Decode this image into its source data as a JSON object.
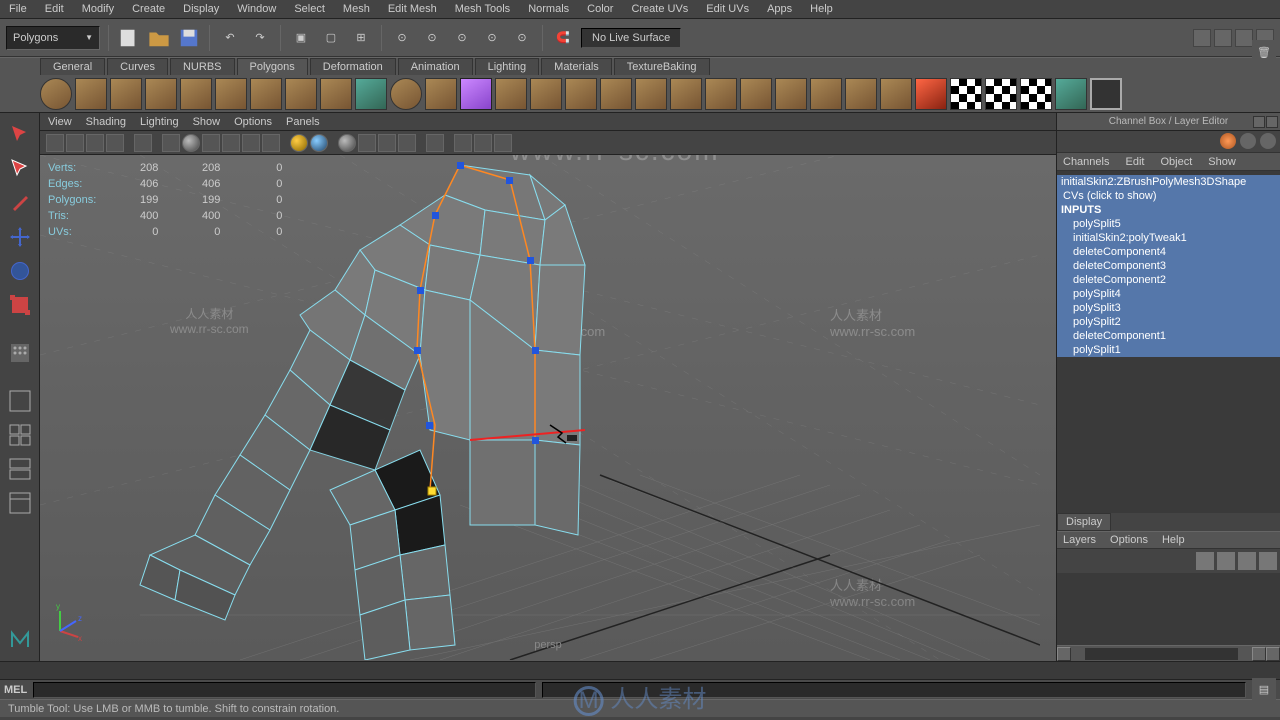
{
  "menus": [
    "File",
    "Edit",
    "Modify",
    "Create",
    "Display",
    "Window",
    "Select",
    "Mesh",
    "Edit Mesh",
    "Mesh Tools",
    "Normals",
    "Color",
    "Create UVs",
    "Edit UVs",
    "Apps",
    "Help"
  ],
  "mode": "Polygons",
  "no_live": "No Live Surface",
  "shelf_tabs": [
    "General",
    "Curves",
    "NURBS",
    "Polygons",
    "Deformation",
    "Animation",
    "Lighting",
    "Materials",
    "TextureBaking"
  ],
  "active_shelf_tab": "Polygons",
  "panel_menu": [
    "View",
    "Shading",
    "Lighting",
    "Show",
    "Options",
    "Panels"
  ],
  "hud": {
    "rows": [
      {
        "label": "Verts:",
        "v1": "208",
        "v2": "208",
        "v3": "0"
      },
      {
        "label": "Edges:",
        "v1": "406",
        "v2": "406",
        "v3": "0"
      },
      {
        "label": "Polygons:",
        "v1": "199",
        "v2": "199",
        "v3": "0"
      },
      {
        "label": "Tris:",
        "v1": "400",
        "v2": "400",
        "v3": "0"
      },
      {
        "label": "UVs:",
        "v1": "0",
        "v2": "0",
        "v3": "0"
      }
    ]
  },
  "camera": "persp",
  "channel_box": {
    "title": "Channel Box / Layer Editor",
    "menu": [
      "Channels",
      "Edit",
      "Object",
      "Show"
    ],
    "shape": "initialSkin2:ZBrushPolyMesh3DShape",
    "cvs": "CVs (click to show)",
    "inputs_label": "INPUTS",
    "inputs": [
      "polySplit5",
      "initialSkin2:polyTweak1",
      "deleteComponent4",
      "deleteComponent3",
      "deleteComponent2",
      "polySplit4",
      "polySplit3",
      "polySplit2",
      "deleteComponent1",
      "polySplit1"
    ]
  },
  "display_tab": "Display",
  "layers_menu": [
    "Layers",
    "Options",
    "Help"
  ],
  "mel_label": "MEL",
  "help_text": "Tumble Tool: Use LMB or MMB to tumble. Shift to constrain rotation.",
  "watermark_url": "www.rr-sc.com",
  "watermark_text": "人人素材"
}
